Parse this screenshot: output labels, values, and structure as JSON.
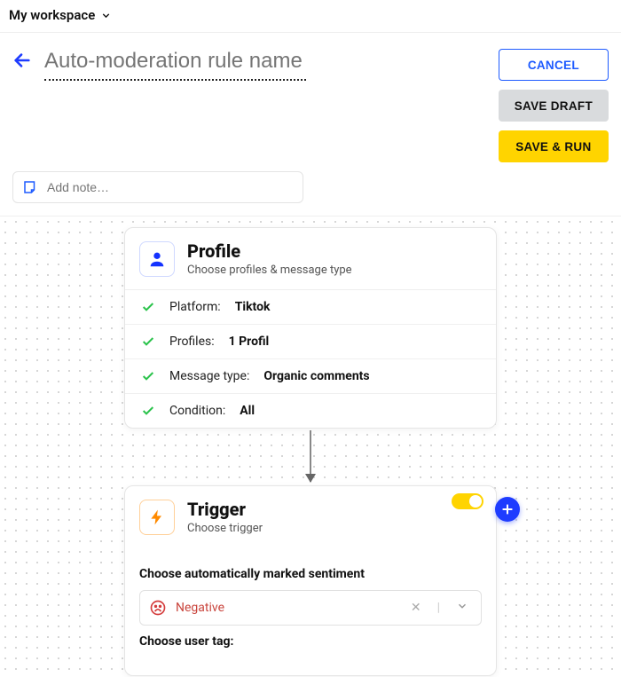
{
  "topbar": {
    "workspace": "My workspace"
  },
  "header": {
    "title_placeholder": "Auto-moderation rule name",
    "cancel": "CANCEL",
    "save_draft": "SAVE DRAFT",
    "save_run": "SAVE & RUN"
  },
  "note": {
    "placeholder": "Add note…"
  },
  "profile_card": {
    "title": "Profile",
    "subtitle": "Choose profiles & message type",
    "rows": [
      {
        "label": "Platform:",
        "value": "Tiktok"
      },
      {
        "label": "Profiles:",
        "value": "1 Profil"
      },
      {
        "label": "Message type:",
        "value": "Organic comments"
      },
      {
        "label": "Condition:",
        "value": "All"
      }
    ]
  },
  "trigger_card": {
    "title": "Trigger",
    "subtitle": "Choose trigger",
    "toggle_on": true,
    "sentiment_label": "Choose automatically marked sentiment",
    "sentiment_value": "Negative",
    "user_tag_label": "Choose user tag:"
  }
}
